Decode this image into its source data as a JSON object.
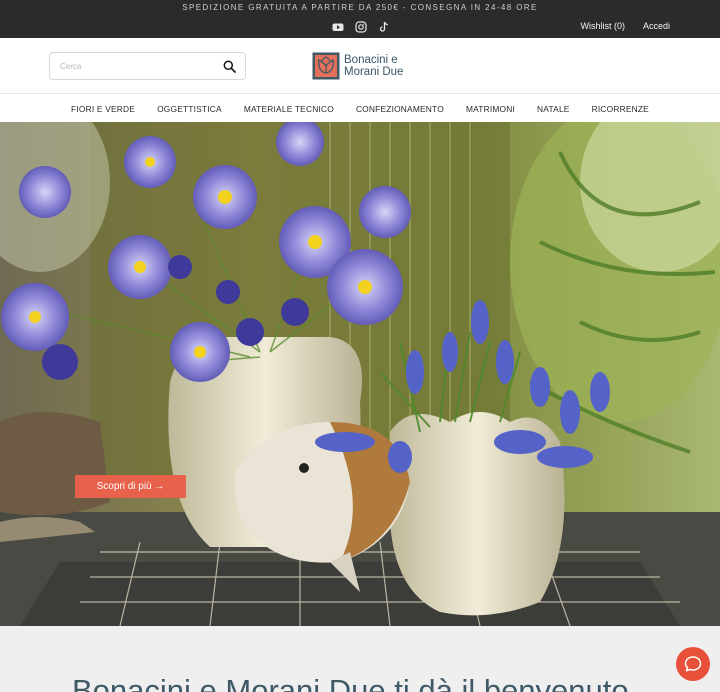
{
  "topbar": {
    "promo": "SPEDIZIONE GRATUITA A PARTIRE DA 250€ - CONSEGNA IN 24-48 ORE",
    "social": [
      "youtube-icon",
      "instagram-icon",
      "tiktok-icon"
    ],
    "wishlist": "Wishlist (0)",
    "login": "Accedi"
  },
  "header": {
    "search_placeholder": "Cerca",
    "search_value": "",
    "logo_line1": "Bonacini e",
    "logo_line2": "Morani Due"
  },
  "nav": {
    "items": [
      "FIORI E VERDE",
      "OGGETTISTICA",
      "MATERIALE TECNICO",
      "CONFEZIONAMENTO",
      "MATRIMONI",
      "NATALE",
      "RICORRENZE"
    ]
  },
  "hero": {
    "cta": "Scopri di più →"
  },
  "welcome": {
    "heading": "Bonacini e Morani Due ti dà il benvenuto"
  },
  "colors": {
    "topbar": "#2b2b2b",
    "accent": "#e8614a",
    "brand_text": "#3a5566",
    "chat": "#e8503a"
  },
  "chat": {
    "icon": "chat-bubble-icon"
  }
}
